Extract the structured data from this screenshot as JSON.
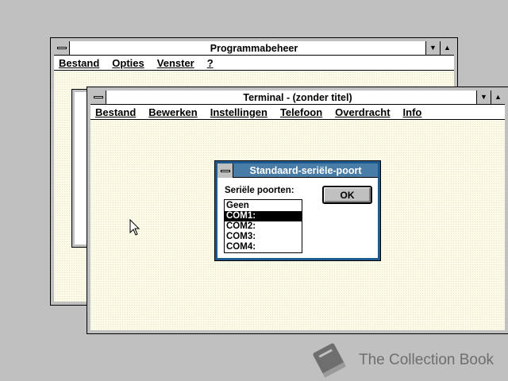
{
  "program_manager": {
    "title": "Programmabeheer",
    "menu": [
      {
        "label": "Bestand",
        "mnemonic": "B"
      },
      {
        "label": "Opties",
        "mnemonic": "O"
      },
      {
        "label": "Venster",
        "mnemonic": "V"
      },
      {
        "label": "?",
        "mnemonic": "?"
      }
    ]
  },
  "terminal": {
    "title": "Terminal - (zonder titel)",
    "menu": [
      {
        "label": "Bestand"
      },
      {
        "label": "Bewerken"
      },
      {
        "label": "Instellingen"
      },
      {
        "label": "Telefoon"
      },
      {
        "label": "Overdracht"
      },
      {
        "label": "Info"
      }
    ]
  },
  "dialog": {
    "title": "Standaard-seriële-poort",
    "ports_label": "Seriële poorten:",
    "ok_label": "OK",
    "ports": [
      "Geen",
      "COM1:",
      "COM2:",
      "COM3:",
      "COM4:"
    ],
    "selected": "COM1:"
  },
  "watermark": {
    "text": "The Collection Book"
  },
  "colors": {
    "desktop": "#c0c0c0",
    "dialog_title": "#4a7ca8",
    "client": "#fbfbe8"
  }
}
